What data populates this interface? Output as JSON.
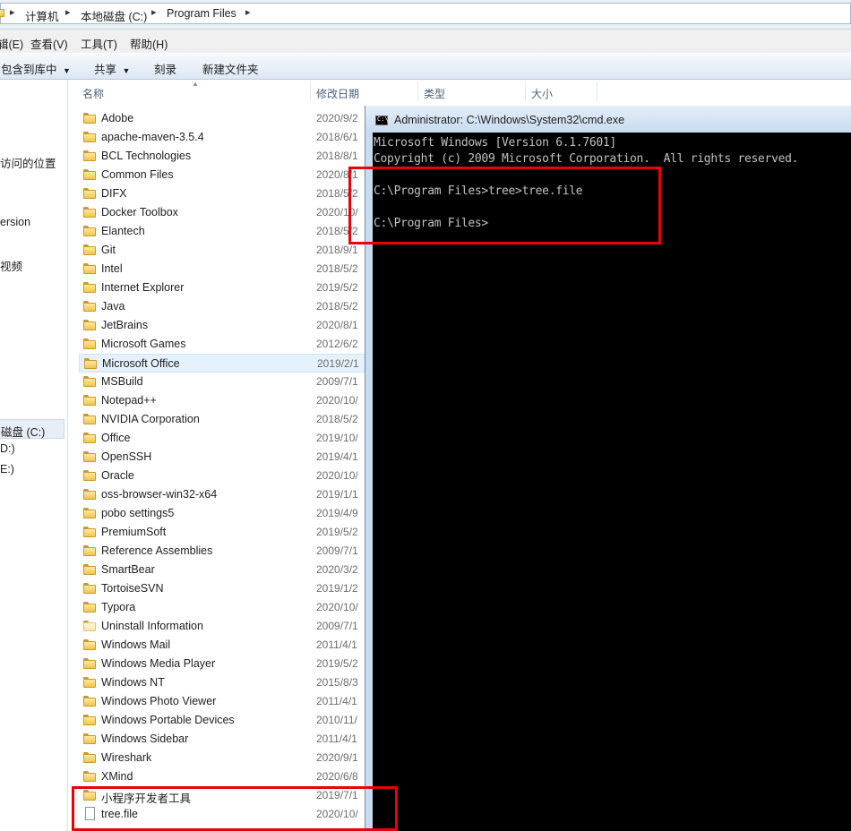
{
  "address": {
    "crumbs": [
      "计算机",
      "本地磁盘 (C:)",
      "Program Files"
    ]
  },
  "menu": [
    "辑(E)",
    "查看(V)",
    "工具(T)",
    "帮助(H)"
  ],
  "toolbar": {
    "include": "包含到库中",
    "share": "共享",
    "burn": "刻录",
    "new_folder": "新建文件夹"
  },
  "nav": {
    "recent": "访问的位置",
    "version": "ersion",
    "video": "视频",
    "c_drive": "磁盘 (C:)",
    "d_drive": "D:)",
    "e_drive": "E:)"
  },
  "columns": [
    "名称",
    "修改日期",
    "类型",
    "大小"
  ],
  "files": [
    {
      "name": "Adobe",
      "date": "2020/9/2",
      "type": "folder"
    },
    {
      "name": "apache-maven-3.5.4",
      "date": "2018/6/1",
      "type": "folder"
    },
    {
      "name": "BCL Technologies",
      "date": "2018/8/1",
      "type": "folder"
    },
    {
      "name": "Common Files",
      "date": "2020/8/1",
      "type": "folder"
    },
    {
      "name": "DIFX",
      "date": "2018/5/2",
      "type": "folder"
    },
    {
      "name": "Docker Toolbox",
      "date": "2020/10/",
      "type": "folder"
    },
    {
      "name": "Elantech",
      "date": "2018/5/2",
      "type": "folder"
    },
    {
      "name": "Git",
      "date": "2018/9/1",
      "type": "folder"
    },
    {
      "name": "Intel",
      "date": "2018/5/2",
      "type": "folder"
    },
    {
      "name": "Internet Explorer",
      "date": "2019/5/2",
      "type": "folder"
    },
    {
      "name": "Java",
      "date": "2018/5/2",
      "type": "folder"
    },
    {
      "name": "JetBrains",
      "date": "2020/8/1",
      "type": "folder"
    },
    {
      "name": "Microsoft Games",
      "date": "2012/6/2",
      "type": "folder"
    },
    {
      "name": "Microsoft Office",
      "date": "2019/2/1",
      "type": "folder",
      "selected": true
    },
    {
      "name": "MSBuild",
      "date": "2009/7/1",
      "type": "folder"
    },
    {
      "name": "Notepad++",
      "date": "2020/10/",
      "type": "folder"
    },
    {
      "name": "NVIDIA Corporation",
      "date": "2018/5/2",
      "type": "folder"
    },
    {
      "name": "Office",
      "date": "2019/10/",
      "type": "folder"
    },
    {
      "name": "OpenSSH",
      "date": "2019/4/1",
      "type": "folder"
    },
    {
      "name": "Oracle",
      "date": "2020/10/",
      "type": "folder"
    },
    {
      "name": "oss-browser-win32-x64",
      "date": "2019/1/1",
      "type": "folder"
    },
    {
      "name": "pobo settings5",
      "date": "2019/4/9",
      "type": "folder"
    },
    {
      "name": "PremiumSoft",
      "date": "2019/5/2",
      "type": "folder"
    },
    {
      "name": "Reference Assemblies",
      "date": "2009/7/1",
      "type": "folder"
    },
    {
      "name": "SmartBear",
      "date": "2020/3/2",
      "type": "folder"
    },
    {
      "name": "TortoiseSVN",
      "date": "2019/1/2",
      "type": "folder"
    },
    {
      "name": "Typora",
      "date": "2020/10/",
      "type": "folder"
    },
    {
      "name": "Uninstall Information",
      "date": "2009/7/1",
      "type": "folder-pale"
    },
    {
      "name": "Windows Mail",
      "date": "2011/4/1",
      "type": "folder"
    },
    {
      "name": "Windows Media Player",
      "date": "2019/5/2",
      "type": "folder"
    },
    {
      "name": "Windows NT",
      "date": "2015/8/3",
      "type": "folder"
    },
    {
      "name": "Windows Photo Viewer",
      "date": "2011/4/1",
      "type": "folder"
    },
    {
      "name": "Windows Portable Devices",
      "date": "2010/11/",
      "type": "folder"
    },
    {
      "name": "Windows Sidebar",
      "date": "2011/4/1",
      "type": "folder"
    },
    {
      "name": "Wireshark",
      "date": "2020/9/1",
      "type": "folder"
    },
    {
      "name": "XMind",
      "date": "2020/6/8",
      "type": "folder"
    },
    {
      "name": "小程序开发者工具",
      "date": "2019/7/1",
      "type": "folder"
    },
    {
      "name": "tree.file",
      "date": "2020/10/",
      "type": "file"
    }
  ],
  "cmd": {
    "title": "Administrator: C:\\Windows\\System32\\cmd.exe",
    "icon_label": "C:\\",
    "lines": [
      "Microsoft Windows [Version 6.1.7601]",
      "Copyright (c) 2009 Microsoft Corporation.  All rights reserved.",
      "",
      "C:\\Program Files>tree>tree.file",
      "",
      "C:\\Program Files>"
    ]
  },
  "colors": {
    "highlight": "#e8000b",
    "console_bg": "#000000",
    "console_text": "#c0c0c0",
    "selection": "#e5f1fb"
  }
}
